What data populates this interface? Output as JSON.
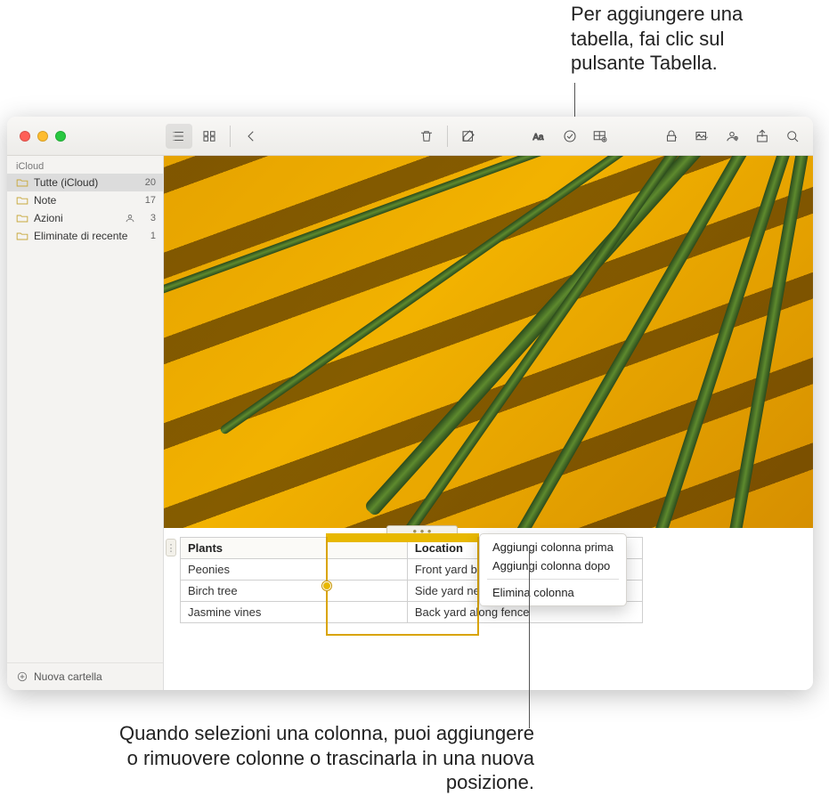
{
  "callouts": {
    "top": "Per aggiungere una tabella, fai clic sul pulsante Tabella.",
    "bottom": "Quando selezioni una colonna, puoi aggiungere o rimuovere colonne o trascinarla in una nuova posizione."
  },
  "sidebar": {
    "heading": "iCloud",
    "items": [
      {
        "label": "Tutte (iCloud)",
        "count": "20",
        "shared": false
      },
      {
        "label": "Note",
        "count": "17",
        "shared": false
      },
      {
        "label": "Azioni",
        "count": "3",
        "shared": true
      },
      {
        "label": "Eliminate di recente",
        "count": "1",
        "shared": false
      }
    ],
    "new_folder": "Nuova cartella"
  },
  "table": {
    "columns": [
      "Plants",
      "Location"
    ],
    "rows": [
      [
        "Peonies",
        "Front yard by driveway"
      ],
      [
        "Birch tree",
        "Side yard near fire pit"
      ],
      [
        "Jasmine vines",
        "Back yard along fence"
      ]
    ]
  },
  "context_menu": {
    "add_before": "Aggiungi colonna prima",
    "add_after": "Aggiungi colonna dopo",
    "delete": "Elimina colonna"
  }
}
